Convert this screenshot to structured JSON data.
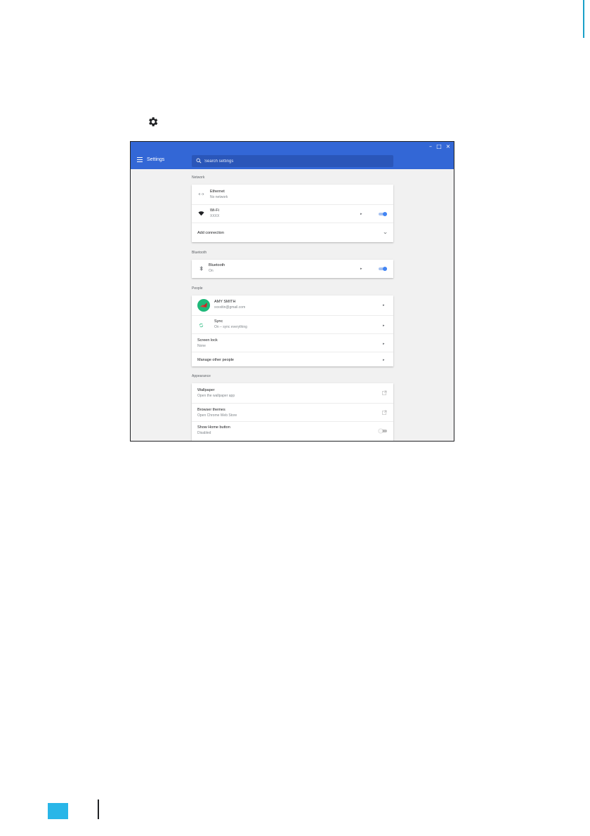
{
  "page": {
    "gear_icon": "gear-icon",
    "footer_color": "#29b6e8"
  },
  "window": {
    "controls": [
      "minimize-icon",
      "maximize-icon",
      "close-icon"
    ],
    "accent": "#3367d6"
  },
  "appbar": {
    "menu_icon": "hamburger-icon",
    "title": "Settings",
    "search_placeholder": "Search settings",
    "search_icon": "search-icon"
  },
  "network": {
    "title": "Network",
    "ethernet": {
      "label": "Ethernet",
      "sub": "No network",
      "icon": "ethernet-icon"
    },
    "wifi": {
      "label": "Wi-Fi",
      "sub": "XXXX",
      "icon": "wifi-icon",
      "enabled": true
    },
    "add_connection": {
      "label": "Add connection",
      "icon": "chevron-down-icon"
    }
  },
  "bluetooth": {
    "title": "Bluetooth",
    "item": {
      "label": "Bluetooth",
      "sub": "On",
      "icon": "bluetooth-icon",
      "enabled": true
    }
  },
  "people": {
    "title": "People",
    "account": {
      "label": "AMY SMITH",
      "sub": "xxxxitin@gmail.com",
      "icon": "avatar"
    },
    "sync": {
      "label": "Sync",
      "sub": "On – sync everything",
      "icon": "sync-icon"
    },
    "screen_lock": {
      "label": "Screen lock",
      "sub": "None"
    },
    "manage": {
      "label": "Manage other people"
    }
  },
  "appearance": {
    "title": "Appearance",
    "wallpaper": {
      "label": "Wallpaper",
      "sub": "Open the wallpaper app",
      "icon": "external-link-icon"
    },
    "themes": {
      "label": "Browser themes",
      "sub": "Open Chrome Web Store",
      "icon": "external-link-icon"
    },
    "home_button": {
      "label": "Show Home button",
      "sub": "Disabled",
      "enabled": false
    }
  }
}
